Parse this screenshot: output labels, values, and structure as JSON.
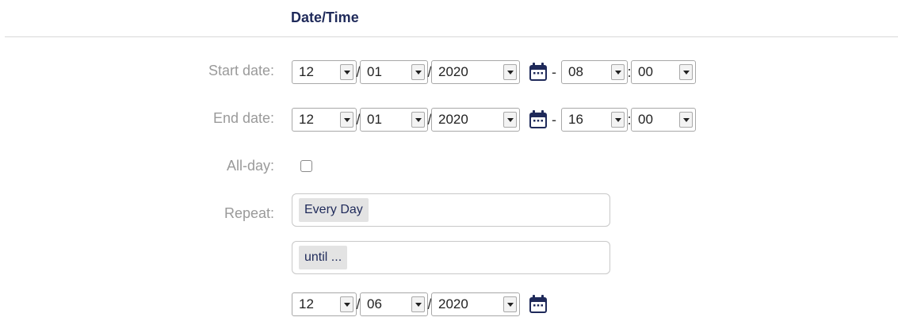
{
  "section": {
    "title": "Date/Time"
  },
  "start_date": {
    "label": "Start date:",
    "day": "12",
    "month": "01",
    "year": "2020",
    "hour": "08",
    "minute": "00"
  },
  "end_date": {
    "label": "End date:",
    "day": "12",
    "month": "01",
    "year": "2020",
    "hour": "16",
    "minute": "00"
  },
  "all_day": {
    "label": "All-day:",
    "checked": false
  },
  "repeat": {
    "label": "Repeat:",
    "frequency": "Every Day",
    "until_option": "until ...",
    "until_date": {
      "day": "12",
      "month": "06",
      "year": "2020"
    }
  },
  "separators": {
    "date": "/",
    "time": ":",
    "range": "-"
  },
  "colors": {
    "title": "#1f2a5a",
    "label": "#9a9a9a",
    "icon": "#1f2a5a"
  },
  "icons": {
    "calendar": "calendar-icon",
    "dropdown": "chevron-down-icon"
  }
}
